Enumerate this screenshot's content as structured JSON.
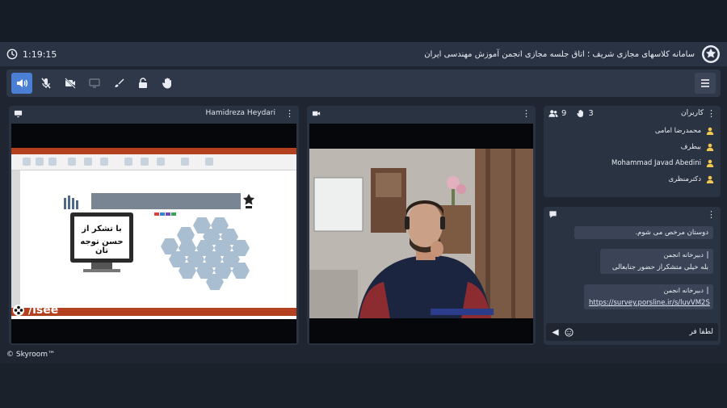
{
  "header": {
    "timer": "1:19:15",
    "title": "سامانه کلاسهای مجازی شریف ؛ اتاق جلسه مجازی انجمن آموزش مهندسی ایران"
  },
  "toolbar": {
    "tools": [
      "speaker-icon",
      "mic-muted-icon",
      "camera-off-icon",
      "screen-share-icon",
      "brush-icon",
      "lock-icon",
      "raise-hand-icon"
    ],
    "active_tool": "speaker-icon",
    "accent_color": "#4a7fd4"
  },
  "share_panel": {
    "presenter": "Hamidreza Heydari",
    "slide_text_line1": "با تشکر از",
    "slide_text_line2": "حسن توجه تان",
    "watermark": "/isee"
  },
  "users_panel": {
    "title": "کاربران",
    "hand_count": "3",
    "user_count": "9",
    "users": [
      "محمدرضا امامی",
      "بیطرف",
      "Mohammad Javad Abedini",
      "دکترمنظری"
    ],
    "user_icon_color": "#f2c94c"
  },
  "chat": {
    "messages": [
      {
        "author": "",
        "text": "دوستان مرخص می شوم."
      },
      {
        "author": "دبیرخانه انجمن",
        "text": "بله خیلی متشکراز حضور جنابعالی"
      },
      {
        "author": "دبیرخانه انجمن",
        "text": "https://survey.porsline.ir/s/luvVM2S"
      }
    ],
    "input_value": "لطفا فر"
  },
  "footer": {
    "brand": "© Skyroom™"
  }
}
